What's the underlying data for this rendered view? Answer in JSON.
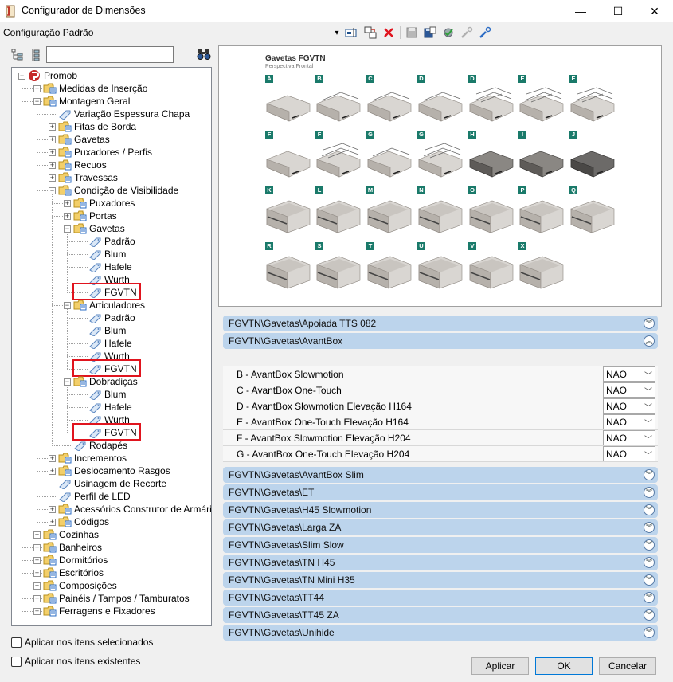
{
  "window": {
    "title": "Configurador de Dimensões",
    "minimize": "—",
    "maximize": "☐",
    "close": "✕"
  },
  "toolbar": {
    "config_label": "Configuração Padrão",
    "dropdown_arrow": "▾",
    "icons": [
      "edit-icon",
      "copy-icon",
      "delete-icon",
      "save-icon",
      "save-as-icon",
      "check-settings-icon",
      "link-disabled-icon",
      "link-icon"
    ]
  },
  "search": {
    "value": "",
    "placeholder": ""
  },
  "tree": {
    "nodes": [
      {
        "label": "Promob",
        "level": 0,
        "icon": "promob",
        "exp": "−"
      },
      {
        "label": "Medidas de Inserção",
        "level": 1,
        "icon": "folder",
        "exp": "+"
      },
      {
        "label": "Montagem Geral",
        "level": 1,
        "icon": "folder",
        "exp": "−"
      },
      {
        "label": "Variação Espessura Chapa",
        "level": 2,
        "icon": "tag",
        "exp": ""
      },
      {
        "label": "Fitas de Borda",
        "level": 2,
        "icon": "folder",
        "exp": "+"
      },
      {
        "label": "Gavetas",
        "level": 2,
        "icon": "folder",
        "exp": "+"
      },
      {
        "label": "Puxadores / Perfis",
        "level": 2,
        "icon": "folder",
        "exp": "+"
      },
      {
        "label": "Recuos",
        "level": 2,
        "icon": "folder",
        "exp": "+"
      },
      {
        "label": "Travessas",
        "level": 2,
        "icon": "folder",
        "exp": "+"
      },
      {
        "label": "Condição de Visibilidade",
        "level": 2,
        "icon": "folder",
        "exp": "−"
      },
      {
        "label": "Puxadores",
        "level": 3,
        "icon": "folder",
        "exp": "+"
      },
      {
        "label": "Portas",
        "level": 3,
        "icon": "folder",
        "exp": "+"
      },
      {
        "label": "Gavetas",
        "level": 3,
        "icon": "folder",
        "exp": "−"
      },
      {
        "label": "Padrão",
        "level": 4,
        "icon": "tag",
        "exp": ""
      },
      {
        "label": "Blum",
        "level": 4,
        "icon": "tag",
        "exp": ""
      },
      {
        "label": "Hafele",
        "level": 4,
        "icon": "tag",
        "exp": ""
      },
      {
        "label": "Wurth",
        "level": 4,
        "icon": "tag",
        "exp": ""
      },
      {
        "label": "FGVTN",
        "level": 4,
        "icon": "tag",
        "exp": "",
        "highlight": true
      },
      {
        "label": "Articuladores",
        "level": 3,
        "icon": "folder",
        "exp": "−"
      },
      {
        "label": "Padrão",
        "level": 4,
        "icon": "tag",
        "exp": ""
      },
      {
        "label": "Blum",
        "level": 4,
        "icon": "tag",
        "exp": ""
      },
      {
        "label": "Hafele",
        "level": 4,
        "icon": "tag",
        "exp": ""
      },
      {
        "label": "Wurth",
        "level": 4,
        "icon": "tag",
        "exp": ""
      },
      {
        "label": "FGVTN",
        "level": 4,
        "icon": "tag",
        "exp": "",
        "highlight": true
      },
      {
        "label": "Dobradiças",
        "level": 3,
        "icon": "folder",
        "exp": "−"
      },
      {
        "label": "Blum",
        "level": 4,
        "icon": "tag",
        "exp": ""
      },
      {
        "label": "Hafele",
        "level": 4,
        "icon": "tag",
        "exp": ""
      },
      {
        "label": "Wurth",
        "level": 4,
        "icon": "tag",
        "exp": ""
      },
      {
        "label": "FGVTN",
        "level": 4,
        "icon": "tag",
        "exp": "",
        "highlight": true
      },
      {
        "label": "Rodapés",
        "level": 3,
        "icon": "tag",
        "exp": ""
      },
      {
        "label": "Incrementos",
        "level": 2,
        "icon": "folder",
        "exp": "+"
      },
      {
        "label": "Deslocamento Rasgos",
        "level": 2,
        "icon": "folder",
        "exp": "+"
      },
      {
        "label": "Usinagem de Recorte",
        "level": 2,
        "icon": "tag",
        "exp": ""
      },
      {
        "label": "Perfil de LED",
        "level": 2,
        "icon": "tag",
        "exp": ""
      },
      {
        "label": "Acessórios Construtor de Armários",
        "level": 2,
        "icon": "folder",
        "exp": "+"
      },
      {
        "label": "Códigos",
        "level": 2,
        "icon": "folder",
        "exp": "+"
      },
      {
        "label": "Cozinhas",
        "level": 1,
        "icon": "folder",
        "exp": "+"
      },
      {
        "label": "Banheiros",
        "level": 1,
        "icon": "folder",
        "exp": "+"
      },
      {
        "label": "Dormitórios",
        "level": 1,
        "icon": "folder",
        "exp": "+"
      },
      {
        "label": "Escritórios",
        "level": 1,
        "icon": "folder",
        "exp": "+"
      },
      {
        "label": "Composições",
        "level": 1,
        "icon": "folder",
        "exp": "+"
      },
      {
        "label": "Painéis / Tampos / Tamburatos",
        "level": 1,
        "icon": "folder",
        "exp": "+"
      },
      {
        "label": "Ferragens e Fixadores",
        "level": 1,
        "icon": "folder",
        "exp": "+"
      }
    ]
  },
  "preview": {
    "title": "Gavetas FGVTN",
    "subtitle": "Perspectiva Frontal",
    "rows": [
      {
        "labels": [
          "A",
          "B",
          "C",
          "D",
          "D",
          "E",
          "E"
        ],
        "style": [
          "open",
          "rail",
          "rail",
          "rail",
          "rail2",
          "rail2",
          "rail2"
        ]
      },
      {
        "labels": [
          "F",
          "F",
          "G",
          "G",
          "H",
          "I",
          "J"
        ],
        "style": [
          "open",
          "rail2",
          "rail",
          "rail2",
          "dark",
          "dark",
          "darkbox"
        ]
      },
      {
        "labels": [
          "K",
          "L",
          "M",
          "N",
          "O",
          "P",
          "Q"
        ],
        "style": [
          "box",
          "box",
          "box",
          "box",
          "box",
          "box",
          "box"
        ]
      },
      {
        "labels": [
          "R",
          "S",
          "T",
          "U",
          "V",
          "X"
        ],
        "style": [
          "box",
          "box",
          "box",
          "box",
          "box",
          "box"
        ]
      }
    ]
  },
  "sections": [
    {
      "title": "FGVTN\\Gavetas\\Apoiada TTS 082",
      "expanded": false
    },
    {
      "title": "FGVTN\\Gavetas\\AvantBox",
      "expanded": true,
      "props": [
        {
          "label": "B - AvantBox Slowmotion",
          "value": "NAO"
        },
        {
          "label": "C - AvantBox One-Touch",
          "value": "NAO"
        },
        {
          "label": "D - AvantBox Slowmotion Elevação H164",
          "value": "NAO"
        },
        {
          "label": "E - AvantBox One-Touch Elevação H164",
          "value": "NAO"
        },
        {
          "label": "F - AvantBox Slowmotion Elevação H204",
          "value": "NAO"
        },
        {
          "label": "G - AvantBox One-Touch Elevação H204",
          "value": "NAO"
        }
      ]
    },
    {
      "title": "FGVTN\\Gavetas\\AvantBox Slim",
      "expanded": false
    },
    {
      "title": "FGVTN\\Gavetas\\ET",
      "expanded": false
    },
    {
      "title": "FGVTN\\Gavetas\\H45 Slowmotion",
      "expanded": false
    },
    {
      "title": "FGVTN\\Gavetas\\Larga ZA",
      "expanded": false
    },
    {
      "title": "FGVTN\\Gavetas\\Slim Slow",
      "expanded": false
    },
    {
      "title": "FGVTN\\Gavetas\\TN H45",
      "expanded": false
    },
    {
      "title": "FGVTN\\Gavetas\\TN Mini H35",
      "expanded": false
    },
    {
      "title": "FGVTN\\Gavetas\\TT44",
      "expanded": false
    },
    {
      "title": "FGVTN\\Gavetas\\TT45 ZA",
      "expanded": false
    },
    {
      "title": "FGVTN\\Gavetas\\Unihide",
      "expanded": false
    }
  ],
  "options": {
    "apply_selected": "Aplicar nos itens selecionados",
    "apply_existing": "Aplicar nos itens existentes"
  },
  "buttons": {
    "apply": "Aplicar",
    "ok": "OK",
    "cancel": "Cancelar"
  },
  "colors": {
    "section_bg": "#bcd4ec",
    "highlight_border": "#e0141e",
    "label_teal": "#1a7a6a"
  }
}
